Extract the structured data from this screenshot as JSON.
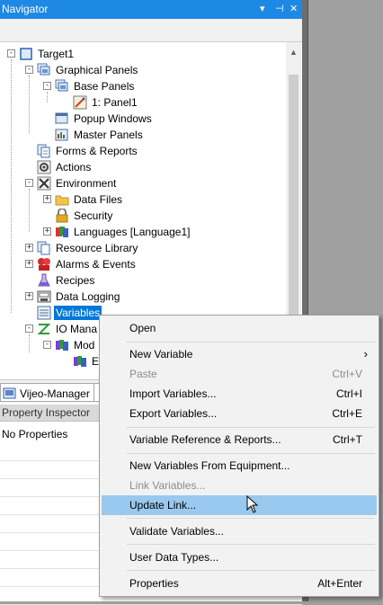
{
  "navigator": {
    "title": "Navigator",
    "title_buttons": {
      "dropdown": "▾",
      "pin": "⊣",
      "close": "✕"
    },
    "tree": [
      {
        "label": "Target1",
        "icon": "target-icon",
        "expander": "-"
      },
      {
        "label": "Graphical Panels",
        "icon": "graphical-panels-icon",
        "expander": "-"
      },
      {
        "label": "Base Panels",
        "icon": "base-panels-icon",
        "expander": "-"
      },
      {
        "label": "1: Panel1",
        "icon": "panel-icon"
      },
      {
        "label": "Popup Windows",
        "icon": "popup-windows-icon"
      },
      {
        "label": "Master Panels",
        "icon": "master-panels-icon"
      },
      {
        "label": "Forms & Reports",
        "icon": "forms-reports-icon"
      },
      {
        "label": "Actions",
        "icon": "actions-icon"
      },
      {
        "label": "Environment",
        "icon": "environment-icon",
        "expander": "-"
      },
      {
        "label": "Data Files",
        "icon": "folder-icon",
        "expander": "+"
      },
      {
        "label": "Security",
        "icon": "security-icon"
      },
      {
        "label": "Languages [Language1]",
        "icon": "languages-icon",
        "expander": "+"
      },
      {
        "label": "Resource Library",
        "icon": "resource-library-icon",
        "expander": "+"
      },
      {
        "label": "Alarms & Events",
        "icon": "alarms-events-icon",
        "expander": "+"
      },
      {
        "label": "Recipes",
        "icon": "recipes-icon"
      },
      {
        "label": "Data Logging",
        "icon": "data-logging-icon",
        "expander": "+"
      },
      {
        "label": "Variables",
        "icon": "variables-icon",
        "selected": true
      },
      {
        "label": "IO Mana",
        "icon": "io-manager-icon",
        "expander": "-"
      },
      {
        "label": "Mod",
        "icon": "modbus-icon",
        "expander": "-"
      },
      {
        "label": "E",
        "icon": "equipment-icon"
      }
    ]
  },
  "tabs": [
    {
      "label": "Vijeo-Manager",
      "icon": "vijeo-manager-icon"
    }
  ],
  "property_inspector": {
    "title": "Property Inspector",
    "empty_text": "No Properties"
  },
  "context_menu": {
    "items": [
      {
        "label": "Open",
        "shortcut": "",
        "disabled": false
      },
      {
        "label": "New Variable",
        "shortcut": "",
        "disabled": false,
        "submenu": "›"
      },
      {
        "label": "Paste",
        "shortcut": "Ctrl+V",
        "disabled": true
      },
      {
        "label": "Import Variables...",
        "shortcut": "Ctrl+I",
        "disabled": false
      },
      {
        "label": "Export Variables...",
        "shortcut": "Ctrl+E",
        "disabled": false
      },
      {
        "label": "Variable Reference & Reports...",
        "shortcut": "Ctrl+T",
        "disabled": false
      },
      {
        "label": "New Variables From Equipment...",
        "shortcut": "",
        "disabled": false
      },
      {
        "label": "Link Variables...",
        "shortcut": "",
        "disabled": true
      },
      {
        "label": "Update Link...",
        "shortcut": "",
        "disabled": false,
        "highlighted": true
      },
      {
        "label": "Validate Variables...",
        "shortcut": "",
        "disabled": false
      },
      {
        "label": "User Data Types...",
        "shortcut": "",
        "disabled": false
      },
      {
        "label": "Properties",
        "shortcut": "Alt+Enter",
        "disabled": false
      }
    ]
  },
  "colors": {
    "title_bar": "#1e88e5",
    "selection": "#0078d7",
    "menu_highlight": "#99c9ef"
  }
}
